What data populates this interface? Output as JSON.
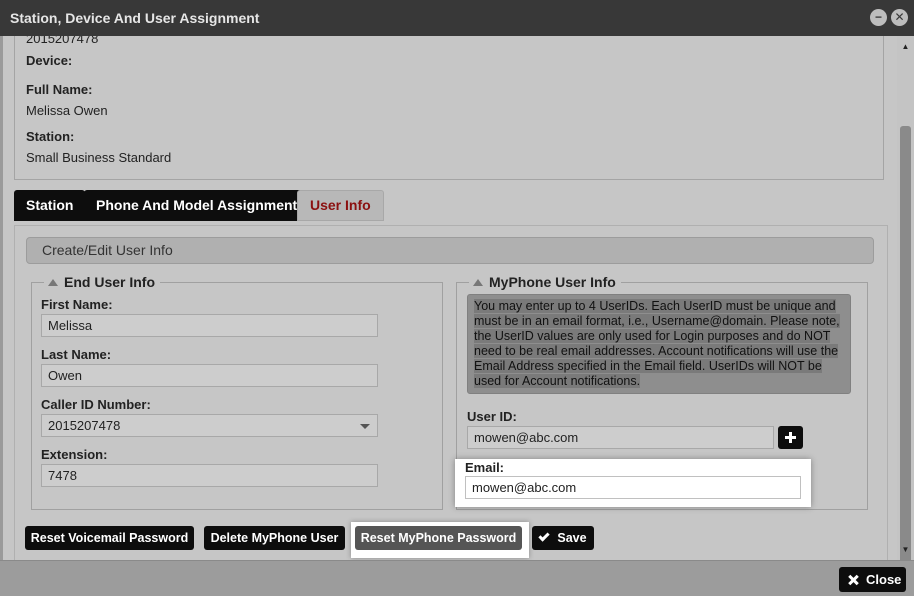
{
  "window": {
    "title": "Station, Device And User Assignment",
    "minimize_icon": "minimize-icon",
    "close_icon": "close-icon",
    "minimize_glyph": "−",
    "close_glyph": "✕"
  },
  "summary": {
    "partial_value": "2015207478",
    "device_label": "Device:",
    "device_value": "",
    "full_name_label": "Full Name:",
    "full_name_value": "Melissa Owen",
    "station_label": "Station:",
    "station_value": "Small Business Standard"
  },
  "tabs": [
    {
      "label": "Station",
      "active": false
    },
    {
      "label": "Phone And Model Assignment",
      "active": false
    },
    {
      "label": "User Info",
      "active": true
    }
  ],
  "panel": {
    "subheader": "Create/Edit User Info"
  },
  "end_user": {
    "legend": "End User Info",
    "first_name_label": "First Name:",
    "first_name_value": "Melissa",
    "last_name_label": "Last Name:",
    "last_name_value": "Owen",
    "caller_id_label": "Caller ID Number:",
    "caller_id_value": "2015207478",
    "extension_label": "Extension:",
    "extension_value": "7478"
  },
  "myphone": {
    "legend": "MyPhone User Info",
    "note": "You may enter up to 4 UserIDs. Each UserID must be unique and must be in an email format, i.e., Username@domain. Please note, the UserID values are only used for Login purposes and do NOT need to be real email addresses. Account notifications will use the Email Address specified in the Email field. UserIDs will NOT be used for Account notifications.",
    "user_id_label": "User ID:",
    "user_id_value": "mowen@abc.com",
    "email_label": "Email:",
    "email_value": "mowen@abc.com"
  },
  "actions": {
    "reset_voicemail": "Reset Voicemail Password",
    "delete_myphone": "Delete MyPhone User",
    "reset_myphone": "Reset MyPhone Password",
    "save": "Save"
  },
  "footer": {
    "close": "Close"
  },
  "colors": {
    "titlebar": "#383838",
    "active_tab_text": "#8b1010",
    "button": "#0d0d0d"
  }
}
